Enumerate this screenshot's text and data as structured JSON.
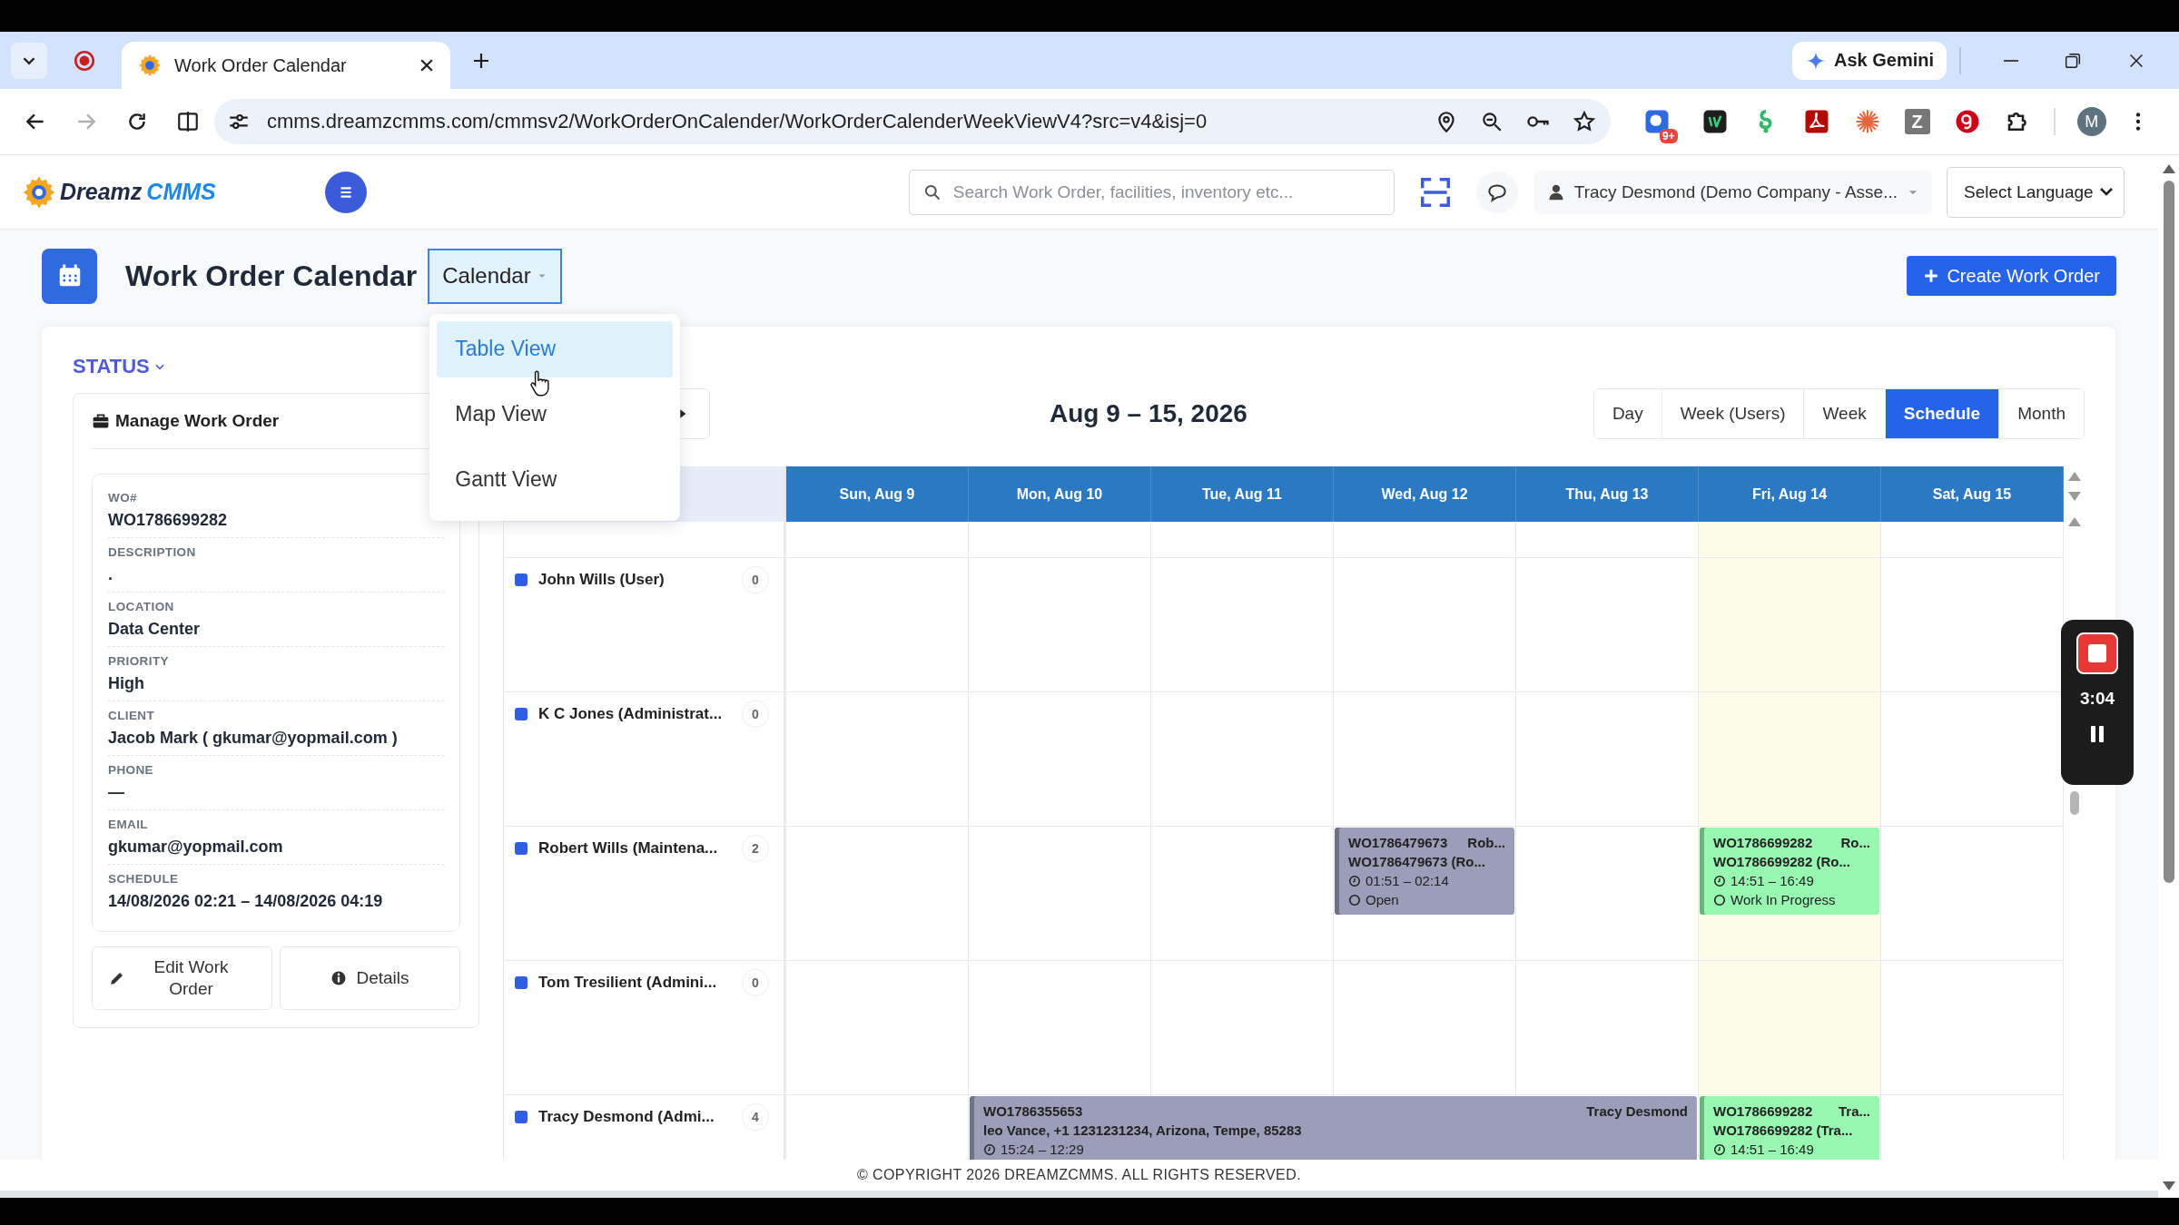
{
  "browser": {
    "tab_title": "Work Order Calendar",
    "gemini": "Ask Gemini",
    "url": "cmms.dreamzcmms.com/cmmsv2/WorkOrderOnCalender/WorkOrderCalenderWeekViewV4?src=v4&isj=0",
    "extension_badge": "9+",
    "extension_letter": "Z",
    "profile": "M"
  },
  "app_header": {
    "logo": {
      "part_1": "Dreamz",
      "part_2": "CMMS"
    },
    "search": {
      "placeholder": "Search Work Order, facilities, inventory etc..."
    },
    "user": "Tracy Desmond (Demo Company - Asse...",
    "language": "Select Language"
  },
  "page": {
    "title": "Work Order Calendar",
    "view_button": "Calendar",
    "create_button": "Create Work Order"
  },
  "view_menu": [
    {
      "label": "Table View",
      "selected": true
    },
    {
      "label": "Map View",
      "selected": false
    },
    {
      "label": "Gantt View",
      "selected": false
    }
  ],
  "status_filter": "STATUS",
  "manage_panel": {
    "title": "Manage Work Order",
    "fields": [
      {
        "label": "WO#",
        "value": "WO1786699282"
      },
      {
        "label": "DESCRIPTION",
        "value": "."
      },
      {
        "label": "LOCATION",
        "value": "Data Center"
      },
      {
        "label": "PRIORITY",
        "value": "High"
      },
      {
        "label": "CLIENT",
        "value": "Jacob Mark ( gkumar@yopmail.com )"
      },
      {
        "label": "PHONE",
        "value": "—"
      },
      {
        "label": "EMAIL",
        "value": "gkumar@yopmail.com"
      },
      {
        "label": "SCHEDULE",
        "value": "14/08/2026 02:21 – 14/08/2026 04:19"
      }
    ],
    "buttons": [
      {
        "label": "Edit Work Order",
        "kind": "edit"
      },
      {
        "label": "Details",
        "kind": "info"
      }
    ]
  },
  "calendar": {
    "range": "Aug 9 – 15, 2026",
    "views": [
      {
        "label": "Day",
        "selected": false
      },
      {
        "label": "Week (Users)",
        "selected": false
      },
      {
        "label": "Week",
        "selected": false
      },
      {
        "label": "Schedule",
        "selected": true
      },
      {
        "label": "Month",
        "selected": false
      }
    ],
    "days": [
      {
        "label": "Sun, Aug 9",
        "today": false
      },
      {
        "label": "Mon, Aug 10",
        "today": false
      },
      {
        "label": "Tue, Aug 11",
        "today": false
      },
      {
        "label": "Wed, Aug 12",
        "today": false
      },
      {
        "label": "Thu, Aug 13",
        "today": false
      },
      {
        "label": "Fri, Aug 14",
        "today": true
      },
      {
        "label": "Sat, Aug 15",
        "today": false
      }
    ],
    "resources": [
      {
        "name": "John Wills (User)",
        "count": "0"
      },
      {
        "name": "K C Jones (Administrat...",
        "count": "0"
      },
      {
        "name": "Robert Wills (Maintena...",
        "count": "2",
        "slots": [
          {
            "kind": "free"
          },
          {
            "kind": "free"
          },
          {
            "kind": "free"
          },
          {
            "kind": "event",
            "color": "#9b9db9",
            "id": "WO1786479673",
            "title": "Rob...",
            "subtitle": "WO1786479673 (Ro...",
            "time": "01:51 – 02:14",
            "status": "Open"
          },
          {
            "kind": "free"
          },
          {
            "kind": "event",
            "color": "#98f8b2",
            "id": "WO1786699282",
            "title": "Ro...",
            "subtitle": "WO1786699282 (Ro...",
            "time": "14:51 – 16:49",
            "status": "Work In Progress"
          },
          {
            "kind": "free"
          }
        ]
      },
      {
        "name": "Tom Tresilient (Admini...",
        "count": "0"
      },
      {
        "name": "Tracy Desmond (Admi...",
        "count": "4",
        "slots": [
          {
            "kind": "free"
          },
          {
            "kind": "event",
            "color": "#9b9db9",
            "id": "WO1786355653",
            "title": "Tracy Desmond",
            "subtitle": "leo Vance, +1 1231231234, Arizona, Tempe, 85283",
            "time": "15:24 – 12:29"
          },
          {
            "kind": "continued"
          },
          {
            "kind": "continued"
          },
          {
            "kind": "continued"
          },
          {
            "kind": "event",
            "color": "#98f8b2",
            "id": "WO1786699282",
            "title": "Tra...",
            "subtitle": "WO1786699282 (Tra...",
            "time": "14:51 – 16:49"
          },
          {
            "kind": "free"
          }
        ]
      }
    ]
  },
  "footer": "© COPYRIGHT 2026 DREAMZCMMS. ALL RIGHTS RESERVED.",
  "recorder": {
    "time": "3:04"
  }
}
